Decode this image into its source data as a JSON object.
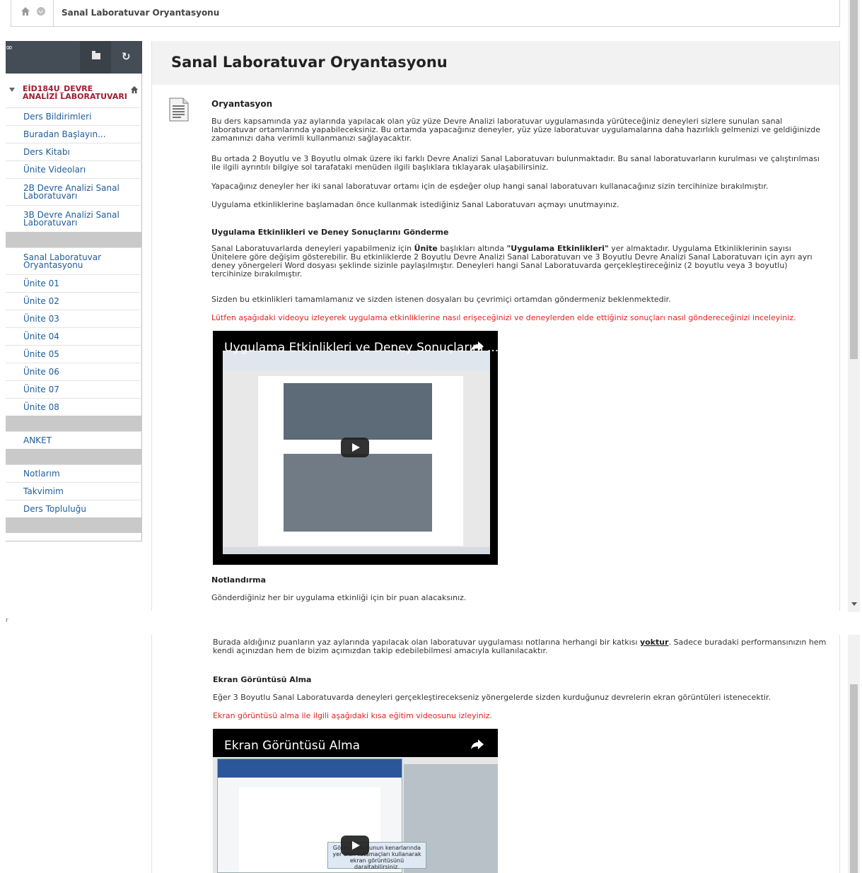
{
  "breadcrumb": {
    "title": "Sanal Laboratuvar Oryantasyonu"
  },
  "sidebar": {
    "course_title": "EİD184U_DEVRE ANALİZİ LABORATUVARI",
    "items": [
      "Ders Bildirimleri",
      "Buradan Başlayın...",
      "Ders Kitabı",
      "Ünite Videoları",
      "2B Devre Analizi Sanal Laboratuvarı",
      "3B Devre Analizi Sanal Laboratuvarı",
      "Sanal Laboratuvar Oryantasyonu",
      "Ünite 01",
      "Ünite 02",
      "Ünite 03",
      "Ünite 04",
      "Ünite 05",
      "Ünite 06",
      "Ünite 07",
      "Ünite 08",
      "ANKET",
      "Notlarım",
      "Takvimim",
      "Ders Topluluğu"
    ]
  },
  "main": {
    "title": "Sanal Laboratuvar Oryantasyonu",
    "section_title": "Oryantasyon",
    "p1": "Bu ders kapsamında yaz aylarında yapılacak olan yüz yüze Devre Analizi laboratuvar uygulamasında yürüteceğiniz deneyleri sizlere sunulan sanal laboratuvar ortamlarında yapabileceksiniz.  Bu ortamda yapacağınız deneyler, yüz yüze laboratuvar uygulamalarına daha hazırlıklı gelmenizi ve geldiğinizde zamanınızı daha verimli kullanmanızı sağlayacaktır.",
    "p2": "Bu ortada 2 Boyutlu ve 3 Boyutlu olmak üzere iki farklı Devre Analizi Sanal Laboratuvarı bulunmaktadır. Bu sanal laboratuvarların kurulması ve çalıştırılması ile ilgili ayrıntılı bilgiye sol tarafataki menüden ilgili başlıklara tıklayarak ulaşabilirsiniz.",
    "p3": "Yapacağınız deneyler her iki sanal laboratuvar ortamı için de eşdeğer olup hangi sanal laboratuvarı kullanacağınız sizin tercihinize bırakılmıştır.",
    "p4": "Uygulama etkinliklerine başlamadan önce kullanmak istediğiniz Sanal Laboratuvarı açmayı unutmayınız.",
    "h_uygulama": "Uygulama Etkinlikleri ve Deney Sonuçlarını Gönderme",
    "p5_a": "Sanal Laboratuvarlarda deneyleri yapabilmeniz için ",
    "p5_b": "Ünite",
    "p5_c": " başlıkları altında ",
    "p5_d": "\"Uygulama Etkinlikleri\"",
    "p5_e": " yer almaktadır. Uygulama Etkinliklerinin sayısı Ünitelere göre değişim gösterebilir. Bu etkinliklerde 2 Boyutlu Devre Analizi Sanal Laboratuvarı ve 3  Boyutlu Devre Analizi Sanal Laboratuvarı için ayrı ayrı deney yönergeleri Word dosyası şeklinde sizinle paylaşılmıştır. Deneyleri hangi Sanal Laboratuvarda gerçekleştireceğiniz (2 boyutlu veya 3 boyutlu) tercihinize bırakılmıştır.",
    "p6": "Sizden bu etkinlikleri tamamlamanız ve sizden istenen dosyaları bu çevrimiçi ortamdan göndermeniz beklenmektedir.",
    "p7_red": "Lütfen aşağıdaki videoyu izleyerek uygulama etkinliklerine nasıl erişeceğinizi ve deneylerden elde ettiğiniz sonuçları nasıl göndereceğinizi inceleyiniz.",
    "video1_title": "Uygulama Etkinlikleri ve Deney Sonuçlarını ...",
    "h_notlandirma": "Notlandırma",
    "p8": "Gönderdiğiniz her bir uygulama etkinliği için bir puan alacaksınız.",
    "p9_a": "Burada aldığınız puanların yaz aylarında yapılacak olan laboratuvar uygulaması notlarına herhangi bir katkısı ",
    "p9_b": "yoktur",
    "p9_c": ". Sadece buradaki performansınızın hem kendi açınızdan hem de bizim açımızdan takip edebilebilmesi amacıyla kullanılacaktır.",
    "h_ekran": "Ekran Görüntüsü Alma",
    "p10": "Eğer 3 Boyutlu Sanal Laboratuvarda deneyleri gerçekleştirecekseniz yönergelerde sizden kurduğunuz devrelerin ekran görüntüleri istenecektir.",
    "p11_red": "Ekran görüntüsü alma ile ilgili aşağıdaki kısa eğitim videosunu izleyiniz.",
    "video2_title": "Ekran Görüntüsü Alma",
    "video2_tooltip": "Görev çubuğunun kenarlarında yer alan tutamaçları kullanarak ekran görüntüsünü daraltabilirsiniz."
  }
}
